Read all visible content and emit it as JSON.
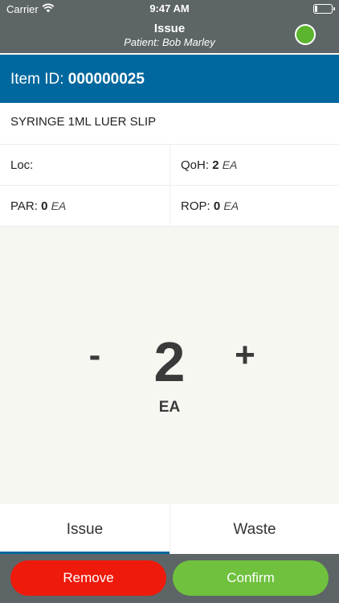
{
  "status_bar": {
    "carrier": "Carrier",
    "time": "9:47 AM",
    "icons": [
      "wifi-icon",
      "battery-icon"
    ],
    "battery_level": 0.15
  },
  "nav": {
    "title": "Issue",
    "subtitle": "Patient: Bob Marley",
    "status_color": "#5bb52f"
  },
  "item": {
    "id_label": "Item ID:",
    "id_value": "000000025",
    "description": "SYRINGE 1ML LUER SLIP"
  },
  "details": {
    "loc_label": "Loc:",
    "loc_value": "",
    "qoh_label": "QoH:",
    "qoh_value": "2",
    "qoh_unit": "EA",
    "par_label": "PAR:",
    "par_value": "0",
    "par_unit": "EA",
    "rop_label": "ROP:",
    "rop_value": "0",
    "rop_unit": "EA"
  },
  "quantity": {
    "minus": "-",
    "value": "2",
    "plus": "+",
    "unit": "EA"
  },
  "tabs": [
    {
      "label": "Issue",
      "active": true
    },
    {
      "label": "Waste",
      "active": false
    }
  ],
  "actions": {
    "remove_label": "Remove",
    "confirm_label": "Confirm"
  },
  "colors": {
    "header": "#5e6567",
    "accent": "#00689e",
    "remove": "#ee1a0c",
    "confirm": "#6fc13e"
  }
}
